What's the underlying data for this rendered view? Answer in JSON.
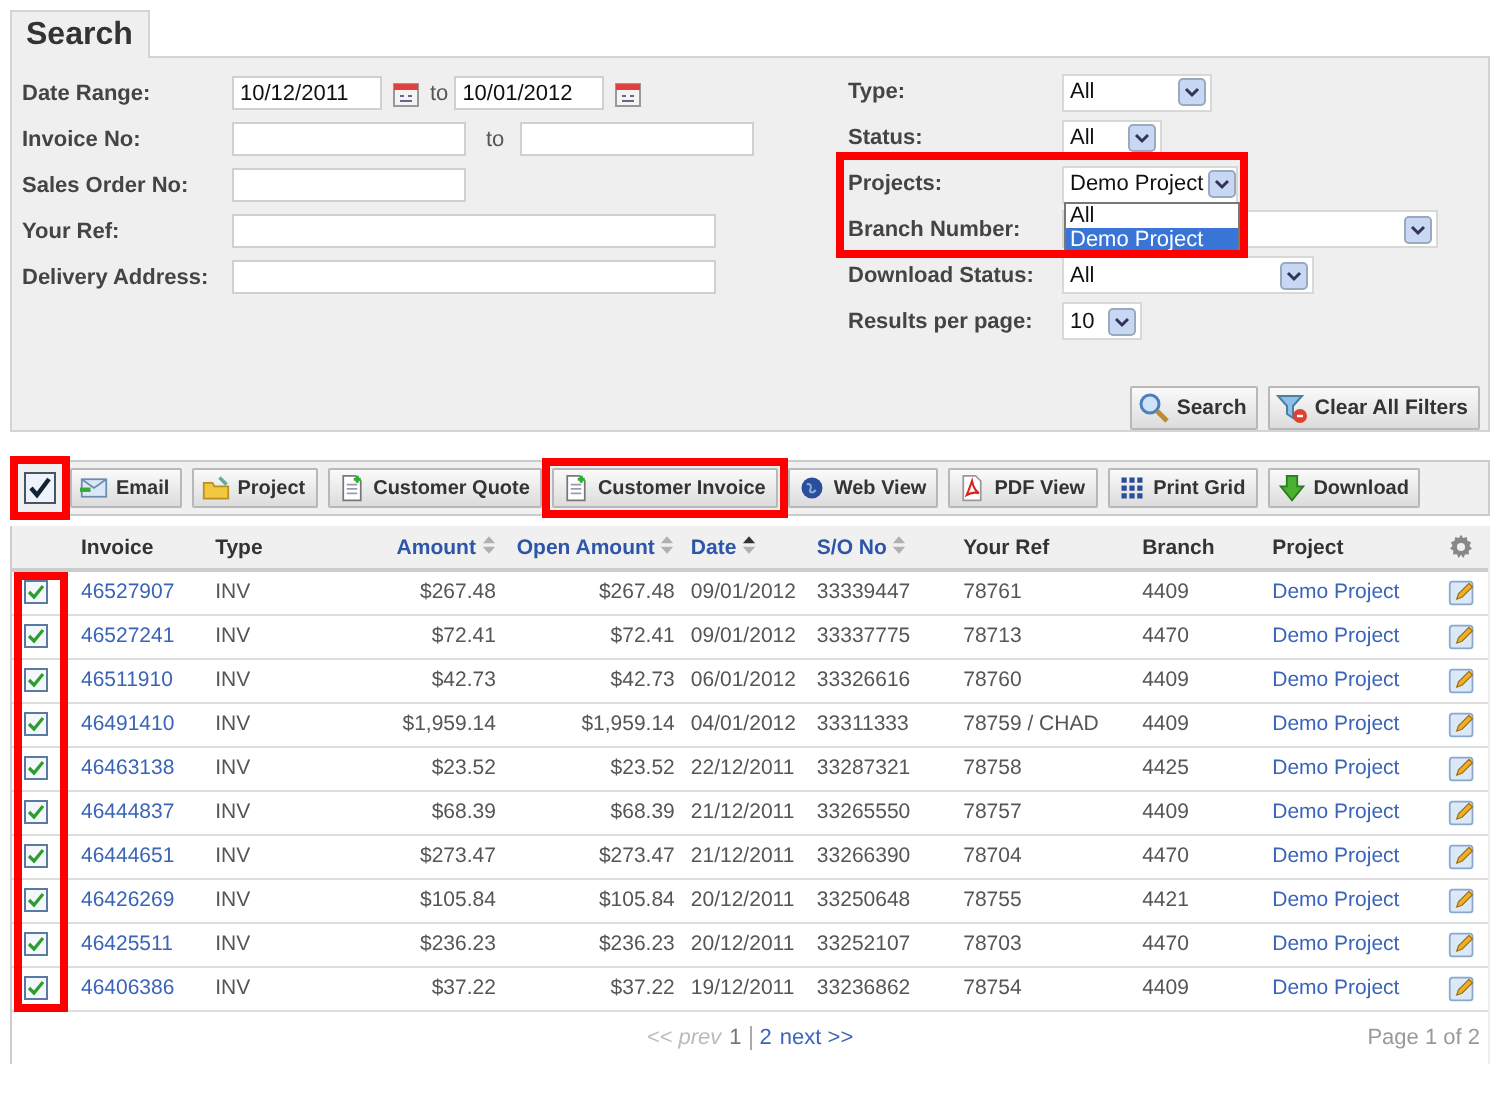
{
  "search_tab": {
    "title": "Search"
  },
  "filters_left": [
    {
      "kind": "date_range",
      "label": "Date Range:",
      "from": "10/12/2011",
      "to_label": "to",
      "to": "10/01/2012"
    },
    {
      "kind": "range",
      "label": "Invoice No:",
      "to_label": "to"
    },
    {
      "kind": "short_text",
      "label": "Sales Order No:"
    },
    {
      "kind": "text",
      "label": "Your Ref:"
    },
    {
      "kind": "text",
      "label": "Delivery Address:"
    }
  ],
  "filters_right": [
    {
      "label": "Type:",
      "value": "All"
    },
    {
      "label": "Status:",
      "value": "All"
    },
    {
      "label": "Projects:",
      "value": "Demo Project",
      "expanded": true,
      "highlighted": true,
      "options": [
        {
          "label": "All",
          "selected": false
        },
        {
          "label": "Demo Project",
          "selected": true
        }
      ]
    },
    {
      "label": "Branch Number:"
    },
    {
      "label": "Download Status:",
      "value": "All"
    },
    {
      "label": "Results per page:",
      "value": "10"
    }
  ],
  "search_buttons": [
    {
      "kind": "search",
      "label": "Search"
    },
    {
      "kind": "clear",
      "label": "Clear All Filters"
    }
  ],
  "toolbar": {
    "select_all": {
      "checked": true,
      "highlighted": true
    },
    "buttons": [
      {
        "kind": "email",
        "label": "Email"
      },
      {
        "kind": "project",
        "label": "Project"
      },
      {
        "kind": "quote",
        "label": "Customer Quote"
      },
      {
        "kind": "invoice",
        "label": "Customer Invoice",
        "highlighted": true
      },
      {
        "kind": "web",
        "label": "Web View"
      },
      {
        "kind": "pdf",
        "label": "PDF View"
      },
      {
        "kind": "grid",
        "label": "Print Grid"
      },
      {
        "kind": "download",
        "label": "Download"
      }
    ]
  },
  "table": {
    "checkbox_column_highlighted": true,
    "columns": [
      {
        "label": "Invoice",
        "sortable": false
      },
      {
        "label": "Type",
        "sortable": false
      },
      {
        "label": "Amount",
        "sortable": true,
        "sorted_ascending": false
      },
      {
        "label": "Open Amount",
        "sortable": true,
        "sorted_ascending": false
      },
      {
        "label": "Date",
        "sortable": true,
        "sorted_ascending": true
      },
      {
        "label": "S/O No",
        "sortable": true,
        "sorted_ascending": false
      },
      {
        "label": "Your Ref",
        "sortable": false
      },
      {
        "label": "Branch",
        "sortable": false
      },
      {
        "label": "Project",
        "sortable": false
      }
    ],
    "rows": [
      {
        "checked": true,
        "invoice": "46527907",
        "type": "INV",
        "amount": "$267.48",
        "open_amount": "$267.48",
        "date": "09/01/2012",
        "so_no": "33339447",
        "your_ref": "78761",
        "branch": "4409",
        "project": "Demo Project"
      },
      {
        "checked": true,
        "invoice": "46527241",
        "type": "INV",
        "amount": "$72.41",
        "open_amount": "$72.41",
        "date": "09/01/2012",
        "so_no": "33337775",
        "your_ref": "78713",
        "branch": "4470",
        "project": "Demo Project"
      },
      {
        "checked": true,
        "invoice": "46511910",
        "type": "INV",
        "amount": "$42.73",
        "open_amount": "$42.73",
        "date": "06/01/2012",
        "so_no": "33326616",
        "your_ref": "78760",
        "branch": "4409",
        "project": "Demo Project"
      },
      {
        "checked": true,
        "invoice": "46491410",
        "type": "INV",
        "amount": "$1,959.14",
        "open_amount": "$1,959.14",
        "date": "04/01/2012",
        "so_no": "33311333",
        "your_ref": "78759 / CHAD",
        "branch": "4409",
        "project": "Demo Project"
      },
      {
        "checked": true,
        "invoice": "46463138",
        "type": "INV",
        "amount": "$23.52",
        "open_amount": "$23.52",
        "date": "22/12/2011",
        "so_no": "33287321",
        "your_ref": "78758",
        "branch": "4425",
        "project": "Demo Project"
      },
      {
        "checked": true,
        "invoice": "46444837",
        "type": "INV",
        "amount": "$68.39",
        "open_amount": "$68.39",
        "date": "21/12/2011",
        "so_no": "33265550",
        "your_ref": "78757",
        "branch": "4409",
        "project": "Demo Project"
      },
      {
        "checked": true,
        "invoice": "46444651",
        "type": "INV",
        "amount": "$273.47",
        "open_amount": "$273.47",
        "date": "21/12/2011",
        "so_no": "33266390",
        "your_ref": "78704",
        "branch": "4470",
        "project": "Demo Project"
      },
      {
        "checked": true,
        "invoice": "46426269",
        "type": "INV",
        "amount": "$105.84",
        "open_amount": "$105.84",
        "date": "20/12/2011",
        "so_no": "33250648",
        "your_ref": "78755",
        "branch": "4421",
        "project": "Demo Project"
      },
      {
        "checked": true,
        "invoice": "46425511",
        "type": "INV",
        "amount": "$236.23",
        "open_amount": "$236.23",
        "date": "20/12/2011",
        "so_no": "33252107",
        "your_ref": "78703",
        "branch": "4470",
        "project": "Demo Project"
      },
      {
        "checked": true,
        "invoice": "46406386",
        "type": "INV",
        "amount": "$37.22",
        "open_amount": "$37.22",
        "date": "19/12/2011",
        "so_no": "33236862",
        "your_ref": "78754",
        "branch": "4409",
        "project": "Demo Project"
      }
    ]
  },
  "pager": {
    "prev": {
      "label": "<< prev",
      "disabled": true
    },
    "pages": [
      {
        "label": "1",
        "selected": true
      },
      {
        "label": "2",
        "selected": false
      }
    ],
    "next": {
      "label": "next >>",
      "disabled": false
    },
    "summary": "Page 1 of 2"
  }
}
